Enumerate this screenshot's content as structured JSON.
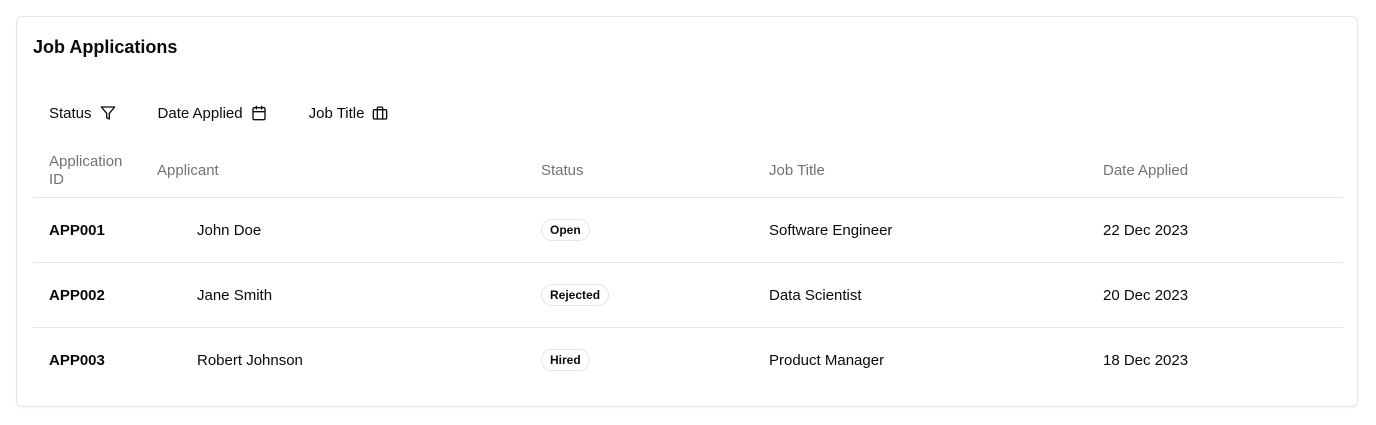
{
  "card": {
    "title": "Job Applications"
  },
  "filters": [
    {
      "label": "Status",
      "icon": "filter-icon"
    },
    {
      "label": "Date Applied",
      "icon": "calendar-icon"
    },
    {
      "label": "Job Title",
      "icon": "briefcase-icon"
    }
  ],
  "table": {
    "headers": {
      "id": "Application ID",
      "applicant": "Applicant",
      "status": "Status",
      "job_title": "Job Title",
      "date": "Date Applied"
    },
    "rows": [
      {
        "id": "APP001",
        "applicant": "John Doe",
        "status": "Open",
        "job_title": "Software Engineer",
        "date": "22 Dec 2023"
      },
      {
        "id": "APP002",
        "applicant": "Jane Smith",
        "status": "Rejected",
        "job_title": "Data Scientist",
        "date": "20 Dec 2023"
      },
      {
        "id": "APP003",
        "applicant": "Robert Johnson",
        "status": "Hired",
        "job_title": "Product Manager",
        "date": "18 Dec 2023"
      }
    ]
  },
  "colors": {
    "text": "#0a0a0a",
    "muted": "#737373",
    "border": "#e5e5e5"
  }
}
